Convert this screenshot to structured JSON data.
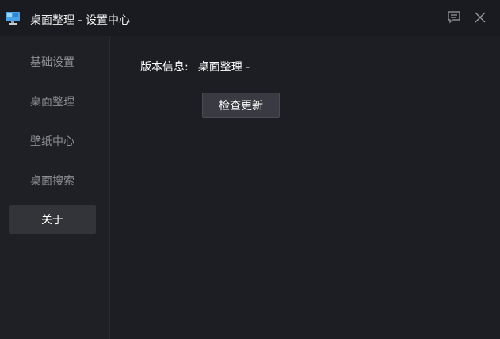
{
  "titlebar": {
    "title": "桌面整理 - 设置中心",
    "app_icon": "monitor-icon",
    "feedback_icon": "feedback-icon",
    "close_icon": "close-icon"
  },
  "sidebar": {
    "items": [
      {
        "label": "基础设置",
        "active": false
      },
      {
        "label": "桌面整理",
        "active": false
      },
      {
        "label": "壁纸中心",
        "active": false
      },
      {
        "label": "桌面搜索",
        "active": false
      },
      {
        "label": "关于",
        "active": true
      }
    ]
  },
  "about": {
    "version_label": "版本信息:",
    "version_value": "桌面整理 -",
    "check_update_button": "检查更新"
  },
  "colors": {
    "background": "#1d1e24",
    "titlebar": "#1a1b20",
    "active_item": "#33343a",
    "button": "#3a3b42"
  }
}
